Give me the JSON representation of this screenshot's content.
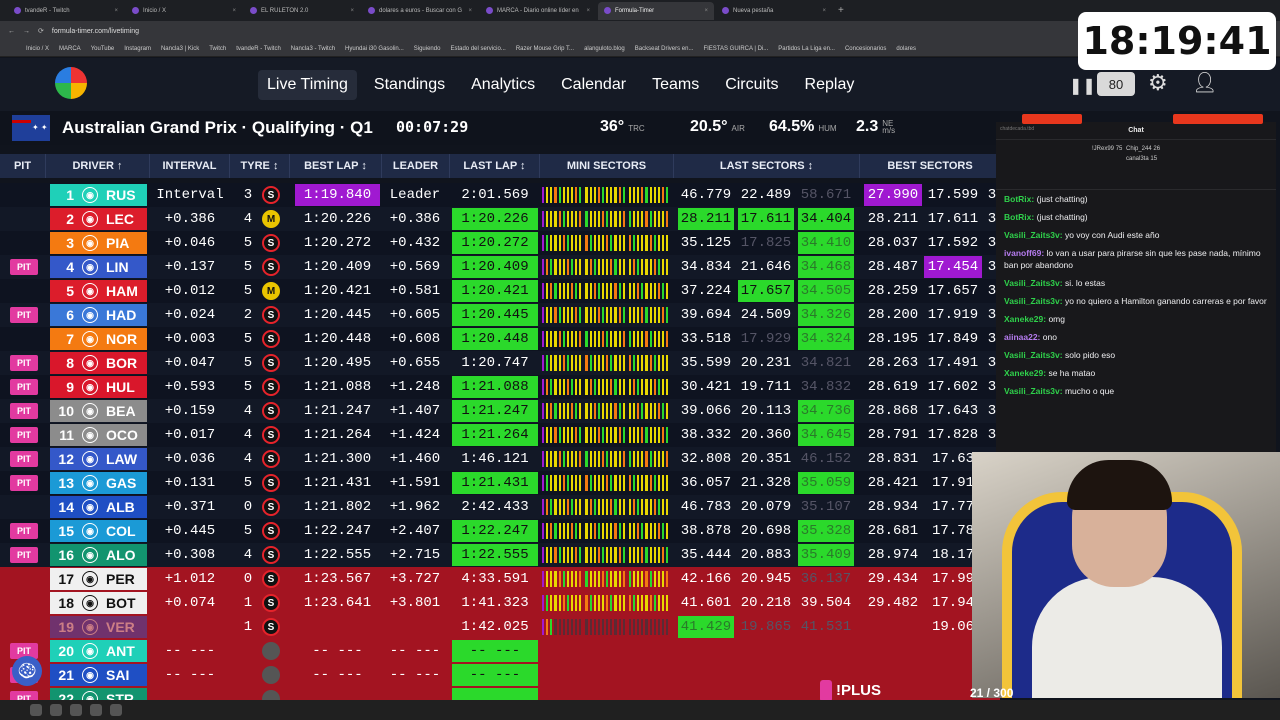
{
  "browser": {
    "tabs": [
      "tvandeR - Twitch",
      "Inicio / X",
      "EL RULETON 2.0",
      "dolares a euros - Buscar con G",
      "MARCA - Diario online líder en",
      "Formula-Timer",
      "Nueva pestaña"
    ],
    "active_tab": 5,
    "url": "formula-timer.com/livetiming",
    "bookmarks": [
      "Inicio / X",
      "MARCA",
      "YouTube",
      "Instagram",
      "Nancla3 | Kick",
      "Twitch",
      "tvandeR - Twitch",
      "Nancla3 - Twitch",
      "Hyundai i30 Gasolin...",
      "Siguiendo",
      "Estado del servicio...",
      "Razer Mouse Grip T...",
      "alanguloto.blog",
      "Backseat Drivers en...",
      "FIESTAS GUIRCA | Di...",
      "Partidos La Liga en...",
      "Concesionarios",
      "dolares"
    ]
  },
  "overlay_clock": "18:19:41",
  "nav": {
    "items": [
      "Live Timing",
      "Standings",
      "Analytics",
      "Calendar",
      "Teams",
      "Circuits",
      "Replay"
    ],
    "active": 0,
    "speed": "80"
  },
  "session": {
    "title": "Australian Grand Prix · Qualifying · Q1",
    "time": "00:07:29",
    "trc": "36°",
    "trc_label": "TRC",
    "air": "20.5°",
    "air_label": "AIR",
    "hum": "64.5%",
    "hum_label": "HUM",
    "wind": "2.3",
    "wind_unit_top": "NE",
    "wind_unit": "m/s"
  },
  "columns": {
    "pit": "PIT",
    "driver": "DRIVER ↑",
    "interval": "INTERVAL",
    "tyre": "TYRE ↕",
    "best": "BEST LAP ↕",
    "leader": "LEADER",
    "last": "LAST LAP ↕",
    "mini": "MINI SECTORS",
    "lastsec": "LAST SECTORS ↕",
    "bestsec": "BEST SECTORS"
  },
  "colors": {
    "purple": "#a019d1",
    "green": "#2bd92b",
    "yellow": "#e9d800",
    "white": "#ffffff",
    "red_band": "#a31421"
  },
  "rows": [
    {
      "pit": "",
      "pos": "1",
      "code": "RUS",
      "team": "#1fd0b8",
      "intv": "Interval",
      "laps": "3",
      "tyre": "S",
      "tc": "#e5232b",
      "best": "1:19.840",
      "bc": "purple",
      "lead": "Leader",
      "last": "2:01.569",
      "lc": "",
      "s": [
        "46.779",
        "22.489",
        "58.671"
      ],
      "sc": [
        "",
        "",
        "dim"
      ],
      "b": [
        "27.990",
        "17.599",
        "3"
      ],
      "bcs": [
        "purple",
        "",
        ""
      ]
    },
    {
      "pit": "",
      "pos": "2",
      "code": "LEC",
      "team": "#dc1d2b",
      "intv": "+0.386",
      "laps": "4",
      "tyre": "M",
      "tc": "#e9c400",
      "best": "1:20.226",
      "bc": "",
      "lead": "+0.386",
      "last": "1:20.226",
      "lc": "green",
      "s": [
        "28.211",
        "17.611",
        "34.404"
      ],
      "sc": [
        "green",
        "green",
        "green"
      ],
      "b": [
        "28.211",
        "17.611",
        "3"
      ],
      "bcs": [
        "",
        "",
        ""
      ]
    },
    {
      "pit": "",
      "pos": "3",
      "code": "PIA",
      "team": "#f47a11",
      "intv": "+0.046",
      "laps": "5",
      "tyre": "S",
      "tc": "#e5232b",
      "best": "1:20.272",
      "bc": "",
      "lead": "+0.432",
      "last": "1:20.272",
      "lc": "green",
      "s": [
        "35.125",
        "17.825",
        "34.410"
      ],
      "sc": [
        "",
        "dim",
        "greendim"
      ],
      "b": [
        "28.037",
        "17.592",
        "3"
      ],
      "bcs": [
        "",
        "",
        ""
      ]
    },
    {
      "pit": "PIT",
      "pos": "4",
      "code": "LIN",
      "team": "#3458c9",
      "intv": "+0.137",
      "laps": "5",
      "tyre": "S",
      "tc": "#e5232b",
      "best": "1:20.409",
      "bc": "",
      "lead": "+0.569",
      "last": "1:20.409",
      "lc": "green",
      "s": [
        "34.834",
        "21.646",
        "34.468"
      ],
      "sc": [
        "",
        "",
        "greendim"
      ],
      "b": [
        "28.487",
        "17.454",
        "3"
      ],
      "bcs": [
        "",
        "purple",
        ""
      ]
    },
    {
      "pit": "",
      "pos": "5",
      "code": "HAM",
      "team": "#dc1d2b",
      "intv": "+0.012",
      "laps": "5",
      "tyre": "M",
      "tc": "#e9c400",
      "best": "1:20.421",
      "bc": "",
      "lead": "+0.581",
      "last": "1:20.421",
      "lc": "green",
      "s": [
        "37.224",
        "17.657",
        "34.505"
      ],
      "sc": [
        "",
        "green",
        "greendim"
      ],
      "b": [
        "28.259",
        "17.657",
        "3"
      ],
      "bcs": [
        "",
        "",
        ""
      ]
    },
    {
      "pit": "PIT",
      "pos": "6",
      "code": "HAD",
      "team": "#3a78d8",
      "intv": "+0.024",
      "laps": "2",
      "tyre": "S",
      "tc": "#e5232b",
      "best": "1:20.445",
      "bc": "",
      "lead": "+0.605",
      "last": "1:20.445",
      "lc": "green",
      "s": [
        "39.694",
        "24.509",
        "34.326"
      ],
      "sc": [
        "",
        "",
        "greendim"
      ],
      "b": [
        "28.200",
        "17.919",
        "3"
      ],
      "bcs": [
        "",
        "",
        ""
      ]
    },
    {
      "pit": "",
      "pos": "7",
      "code": "NOR",
      "team": "#f47a11",
      "intv": "+0.003",
      "laps": "5",
      "tyre": "S",
      "tc": "#e5232b",
      "best": "1:20.448",
      "bc": "",
      "lead": "+0.608",
      "last": "1:20.448",
      "lc": "green",
      "s": [
        "33.518",
        "17.929",
        "34.324"
      ],
      "sc": [
        "",
        "dim",
        "greendim"
      ],
      "b": [
        "28.195",
        "17.849",
        "3"
      ],
      "bcs": [
        "",
        "",
        ""
      ]
    },
    {
      "pit": "PIT",
      "pos": "8",
      "code": "BOR",
      "team": "#d9172b",
      "intv": "+0.047",
      "laps": "5",
      "tyre": "S",
      "tc": "#e5232b",
      "best": "1:20.495",
      "bc": "",
      "lead": "+0.655",
      "last": "1:20.747",
      "lc": "",
      "s": [
        "35.599",
        "20.231",
        "34.821"
      ],
      "sc": [
        "",
        "",
        "dim"
      ],
      "b": [
        "28.263",
        "17.491",
        "3"
      ],
      "bcs": [
        "",
        "",
        ""
      ]
    },
    {
      "pit": "PIT",
      "pos": "9",
      "code": "HUL",
      "team": "#d9172b",
      "intv": "+0.593",
      "laps": "5",
      "tyre": "S",
      "tc": "#e5232b",
      "best": "1:21.088",
      "bc": "",
      "lead": "+1.248",
      "last": "1:21.088",
      "lc": "green",
      "s": [
        "30.421",
        "19.711",
        "34.832"
      ],
      "sc": [
        "",
        "",
        "dim"
      ],
      "b": [
        "28.619",
        "17.602",
        "3"
      ],
      "bcs": [
        "",
        "",
        ""
      ]
    },
    {
      "pit": "PIT",
      "pos": "10",
      "code": "BEA",
      "team": "#8c8c8c",
      "intv": "+0.159",
      "laps": "4",
      "tyre": "S",
      "tc": "#e5232b",
      "best": "1:21.247",
      "bc": "",
      "lead": "+1.407",
      "last": "1:21.247",
      "lc": "green",
      "s": [
        "39.066",
        "20.113",
        "34.736"
      ],
      "sc": [
        "",
        "",
        "greendim"
      ],
      "b": [
        "28.868",
        "17.643",
        "3"
      ],
      "bcs": [
        "",
        "",
        ""
      ]
    },
    {
      "pit": "PIT",
      "pos": "11",
      "code": "OCO",
      "team": "#8c8c8c",
      "intv": "+0.017",
      "laps": "4",
      "tyre": "S",
      "tc": "#e5232b",
      "best": "1:21.264",
      "bc": "",
      "lead": "+1.424",
      "last": "1:21.264",
      "lc": "green",
      "s": [
        "38.332",
        "20.360",
        "34.645"
      ],
      "sc": [
        "",
        "",
        "greendim"
      ],
      "b": [
        "28.791",
        "17.828",
        "3"
      ],
      "bcs": [
        "",
        "",
        ""
      ]
    },
    {
      "pit": "PIT",
      "pos": "12",
      "code": "LAW",
      "team": "#3458c9",
      "intv": "+0.036",
      "laps": "4",
      "tyre": "S",
      "tc": "#e5232b",
      "best": "1:21.300",
      "bc": "",
      "lead": "+1.460",
      "last": "1:46.121",
      "lc": "",
      "s": [
        "32.808",
        "20.351",
        "46.152"
      ],
      "sc": [
        "",
        "",
        "dim"
      ],
      "b": [
        "28.831",
        "17.63",
        ""
      ],
      "bcs": [
        "",
        "",
        ""
      ]
    },
    {
      "pit": "PIT",
      "pos": "13",
      "code": "GAS",
      "team": "#1b9ad6",
      "intv": "+0.131",
      "laps": "5",
      "tyre": "S",
      "tc": "#e5232b",
      "best": "1:21.431",
      "bc": "",
      "lead": "+1.591",
      "last": "1:21.431",
      "lc": "green",
      "s": [
        "36.057",
        "21.328",
        "35.059"
      ],
      "sc": [
        "",
        "",
        "greendim"
      ],
      "b": [
        "28.421",
        "17.91",
        ""
      ],
      "bcs": [
        "",
        "",
        ""
      ]
    },
    {
      "pit": "",
      "pos": "14",
      "code": "ALB",
      "team": "#1f4fc4",
      "intv": "+0.371",
      "laps": "0",
      "tyre": "S",
      "tc": "#e5232b",
      "best": "1:21.802",
      "bc": "",
      "lead": "+1.962",
      "last": "2:42.433",
      "lc": "",
      "s": [
        "46.783",
        "20.079",
        "35.107"
      ],
      "sc": [
        "",
        "",
        "dim"
      ],
      "b": [
        "28.934",
        "17.77",
        ""
      ],
      "bcs": [
        "",
        "",
        ""
      ]
    },
    {
      "pit": "PIT",
      "pos": "15",
      "code": "COL",
      "team": "#1b9ad6",
      "intv": "+0.445",
      "laps": "5",
      "tyre": "S",
      "tc": "#e5232b",
      "best": "1:22.247",
      "bc": "",
      "lead": "+2.407",
      "last": "1:22.247",
      "lc": "green",
      "s": [
        "38.878",
        "20.698",
        "35.328"
      ],
      "sc": [
        "",
        "",
        "greendim"
      ],
      "b": [
        "28.681",
        "17.78",
        ""
      ],
      "bcs": [
        "",
        "",
        ""
      ]
    },
    {
      "pit": "PIT",
      "pos": "16",
      "code": "ALO",
      "team": "#12946f",
      "intv": "+0.308",
      "laps": "4",
      "tyre": "S",
      "tc": "#e5232b",
      "best": "1:22.555",
      "bc": "",
      "lead": "+2.715",
      "last": "1:22.555",
      "lc": "green",
      "s": [
        "35.444",
        "20.883",
        "35.409"
      ],
      "sc": [
        "",
        "",
        "greendim"
      ],
      "b": [
        "28.974",
        "18.17",
        ""
      ],
      "bcs": [
        "",
        "",
        ""
      ]
    },
    {
      "pit": "",
      "pos": "17",
      "code": "PER",
      "team": "#f0f0f0",
      "intv": "+1.012",
      "laps": "0",
      "tyre": "S",
      "tc": "#e5232b",
      "best": "1:23.567",
      "bc": "",
      "lead": "+3.727",
      "last": "4:33.591",
      "lc": "",
      "s": [
        "42.166",
        "20.945",
        "36.137"
      ],
      "sc": [
        "",
        "",
        "dim"
      ],
      "b": [
        "29.434",
        "17.99",
        ""
      ],
      "bcs": [
        "",
        "",
        ""
      ],
      "red": true
    },
    {
      "pit": "",
      "pos": "18",
      "code": "BOT",
      "team": "#f0f0f0",
      "intv": "+0.074",
      "laps": "1",
      "tyre": "S",
      "tc": "#e5232b",
      "best": "1:23.641",
      "bc": "",
      "lead": "+3.801",
      "last": "1:41.323",
      "lc": "",
      "s": [
        "41.601",
        "20.218",
        "39.504"
      ],
      "sc": [
        "",
        "",
        ""
      ],
      "b": [
        "29.482",
        "17.94",
        ""
      ],
      "bcs": [
        "",
        "",
        ""
      ],
      "red": true
    },
    {
      "pit": "",
      "pos": "19",
      "code": "VER",
      "team": "#3458c9",
      "intv": "",
      "laps": "1",
      "tyre": "S",
      "tc": "#e5232b",
      "best": "",
      "bc": "",
      "lead": "",
      "last": "1:42.025",
      "lc": "",
      "s": [
        "41.429",
        "19.865",
        "41.531"
      ],
      "sc": [
        "greendim",
        "dim",
        "dim"
      ],
      "b": [
        "",
        "19.06",
        ""
      ],
      "bcs": [
        "",
        "",
        ""
      ],
      "red": true,
      "dim": true
    },
    {
      "pit": "PIT",
      "pos": "20",
      "code": "ANT",
      "team": "#1fd0b8",
      "intv": "-- ---",
      "laps": "",
      "tyre": "",
      "tc": "#555",
      "best": "-- ---",
      "bc": "",
      "lead": "-- ---",
      "last": "-- ---",
      "lc": "green",
      "s": [
        "",
        "",
        ""
      ],
      "sc": [
        "",
        "",
        ""
      ],
      "b": [
        "",
        "",
        ""
      ],
      "bcs": [
        "",
        "",
        ""
      ],
      "red": true
    },
    {
      "pit": "PIT",
      "pos": "21",
      "code": "SAI",
      "team": "#1f4fc4",
      "intv": "-- ---",
      "laps": "",
      "tyre": "",
      "tc": "#555",
      "best": "-- ---",
      "bc": "",
      "lead": "-- ---",
      "last": "-- ---",
      "lc": "green",
      "s": [
        "",
        "",
        ""
      ],
      "sc": [
        "",
        "",
        ""
      ],
      "b": [
        "",
        "",
        ""
      ],
      "bcs": [
        "",
        "",
        ""
      ],
      "red": true
    },
    {
      "pit": "PIT",
      "pos": "22",
      "code": "STR",
      "team": "#12946f",
      "intv": "",
      "laps": "",
      "tyre": "",
      "tc": "#555",
      "best": "",
      "bc": "",
      "lead": "",
      "last": "",
      "lc": "green",
      "s": [
        "",
        "",
        ""
      ],
      "sc": [
        "",
        "",
        ""
      ],
      "b": [
        "",
        "",
        ""
      ],
      "bcs": [
        "",
        "",
        ""
      ],
      "red": true
    }
  ],
  "chat": {
    "title": "Chat",
    "search": "chatdecada.tbd",
    "top": [
      "!JRex99",
      "Chip_244",
      "canal3ta"
    ],
    "top_counts": [
      "75",
      "26",
      "15"
    ],
    "messages": [
      {
        "user": "BotRix:",
        "color": "#2fd14b",
        "text": "(just chatting)"
      },
      {
        "user": "BotRix:",
        "color": "#2fd14b",
        "text": "(just chatting)"
      },
      {
        "user": "Vasili_Zaits3v:",
        "color": "#2fd14b",
        "text": "yo voy con Audi este año"
      },
      {
        "user": "ivanoff69:",
        "color": "#b67cf0",
        "text": "lo van a usar para pirarse sin que les pase nada, mínimo ban por abandono"
      },
      {
        "user": "Vasili_Zaits3v:",
        "color": "#2fd14b",
        "text": "si. lo estas"
      },
      {
        "user": "Vasili_Zaits3v:",
        "color": "#2fd14b",
        "text": "yo no quiero a Hamilton ganando carreras e por favor"
      },
      {
        "user": "Xaneke29:",
        "color": "#2fd14b",
        "text": "omg"
      },
      {
        "user": "aiinaa22:",
        "color": "#b67cf0",
        "text": "ono"
      },
      {
        "user": "Vasili_Zaits3v:",
        "color": "#2fd14b",
        "text": "solo pido eso"
      },
      {
        "user": "Xaneke29:",
        "color": "#2fd14b",
        "text": "se ha matao"
      },
      {
        "user": "Vasili_Zaits3v:",
        "color": "#2fd14b",
        "text": "mucho o que"
      }
    ]
  },
  "overlay": {
    "plus": "!PLUS",
    "subs": "21 / 300"
  }
}
